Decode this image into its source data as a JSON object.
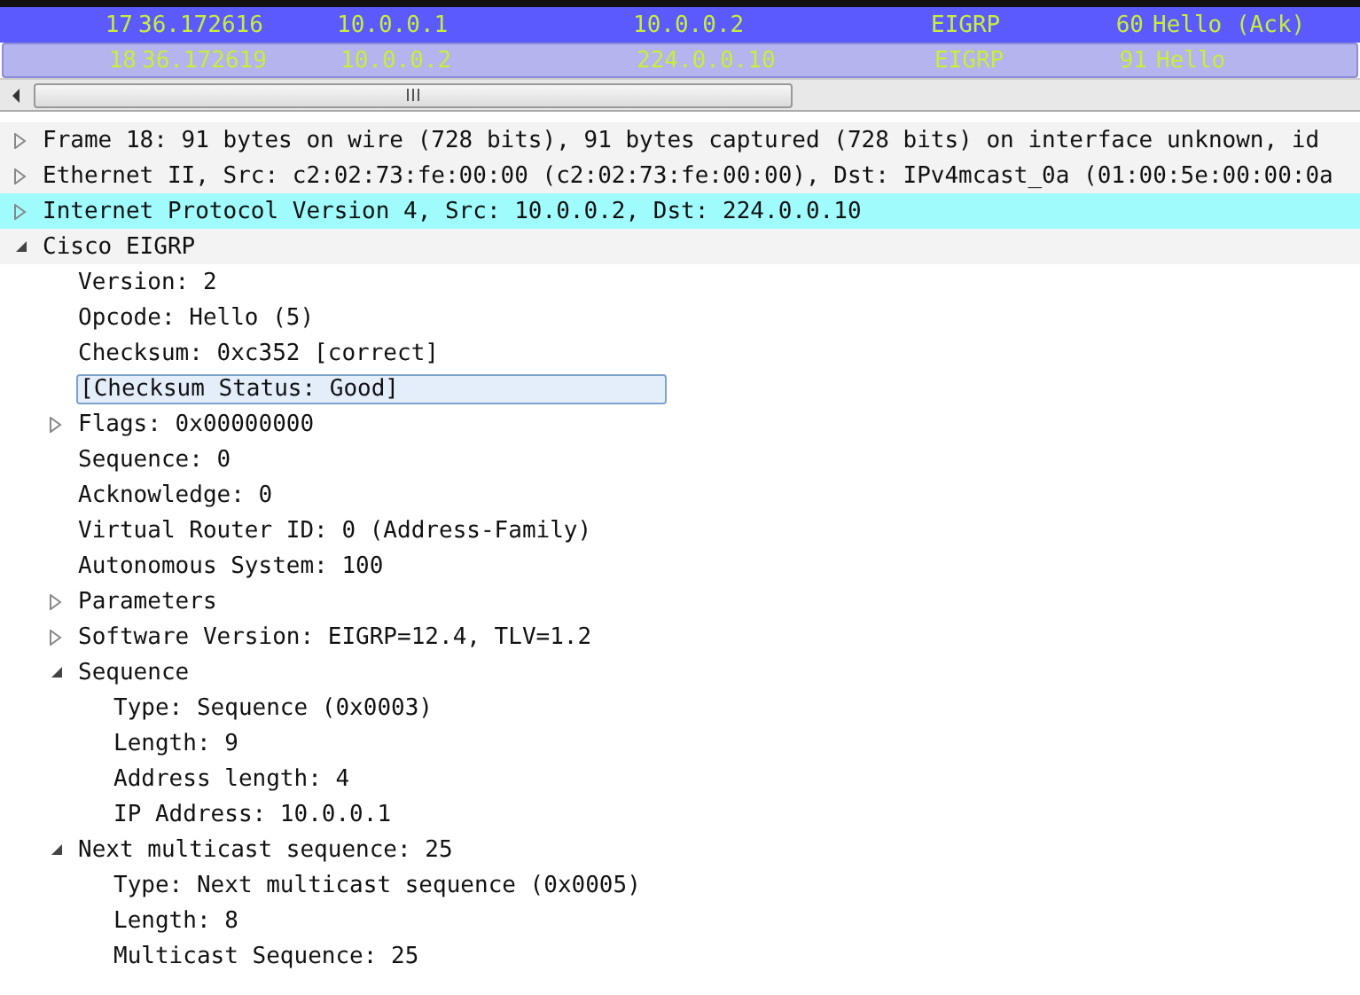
{
  "packet_list": {
    "rows": [
      {
        "no": "17",
        "time": "36.172616",
        "source": "10.0.0.1",
        "destination": "10.0.0.2",
        "protocol": "EIGRP",
        "length": "60",
        "info": "Hello (Ack)",
        "selected": false
      },
      {
        "no": "18",
        "time": "36.172619",
        "source": "10.0.0.2",
        "destination": "224.0.0.10",
        "protocol": "EIGRP",
        "length": "91",
        "info": "Hello",
        "selected": true
      }
    ]
  },
  "details": [
    {
      "text": "Frame 18: 91 bytes on wire (728 bits), 91 bytes captured (728 bits) on interface unknown, id",
      "expanded": false,
      "highlighted": false,
      "selected": false
    },
    {
      "text": "Ethernet II, Src: c2:02:73:fe:00:00 (c2:02:73:fe:00:00), Dst: IPv4mcast_0a (01:00:5e:00:00:0a",
      "expanded": false,
      "highlighted": false,
      "selected": false
    },
    {
      "text": "Internet Protocol Version 4, Src: 10.0.0.2, Dst: 224.0.0.10",
      "expanded": false,
      "highlighted": true,
      "selected": false
    },
    {
      "text": "Cisco EIGRP",
      "expanded": true,
      "highlighted": false,
      "selected": false,
      "children": [
        {
          "text": "Version: 2",
          "highlighted": false,
          "selected": false
        },
        {
          "text": "Opcode: Hello (5)",
          "highlighted": false,
          "selected": false
        },
        {
          "text": "Checksum: 0xc352 [correct]",
          "highlighted": false,
          "selected": false
        },
        {
          "text": "[Checksum Status: Good]",
          "highlighted": false,
          "selected": true
        },
        {
          "text": "Flags: 0x00000000",
          "expanded": false,
          "highlighted": false,
          "selected": false
        },
        {
          "text": "Sequence: 0",
          "highlighted": false,
          "selected": false
        },
        {
          "text": "Acknowledge: 0",
          "highlighted": false,
          "selected": false
        },
        {
          "text": "Virtual Router ID: 0 (Address-Family)",
          "highlighted": false,
          "selected": false
        },
        {
          "text": "Autonomous System: 100",
          "highlighted": false,
          "selected": false
        },
        {
          "text": "Parameters",
          "expanded": false,
          "highlighted": false,
          "selected": false
        },
        {
          "text": "Software Version: EIGRP=12.4, TLV=1.2",
          "expanded": false,
          "highlighted": false,
          "selected": false
        },
        {
          "text": "Sequence",
          "expanded": true,
          "highlighted": false,
          "selected": false,
          "children": [
            {
              "text": "Type: Sequence (0x0003)",
              "highlighted": false,
              "selected": false
            },
            {
              "text": "Length: 9",
              "highlighted": false,
              "selected": false
            },
            {
              "text": "Address length: 4",
              "highlighted": false,
              "selected": false
            },
            {
              "text": "IP Address: 10.0.0.1",
              "highlighted": false,
              "selected": false
            }
          ]
        },
        {
          "text": "Next multicast sequence: 25",
          "expanded": true,
          "highlighted": false,
          "selected": false,
          "children": [
            {
              "text": "Type: Next multicast sequence (0x0005)",
              "highlighted": false,
              "selected": false
            },
            {
              "text": "Length: 8",
              "highlighted": false,
              "selected": false
            },
            {
              "text": "Multicast Sequence: 25",
              "highlighted": false,
              "selected": false
            }
          ]
        }
      ]
    }
  ]
}
